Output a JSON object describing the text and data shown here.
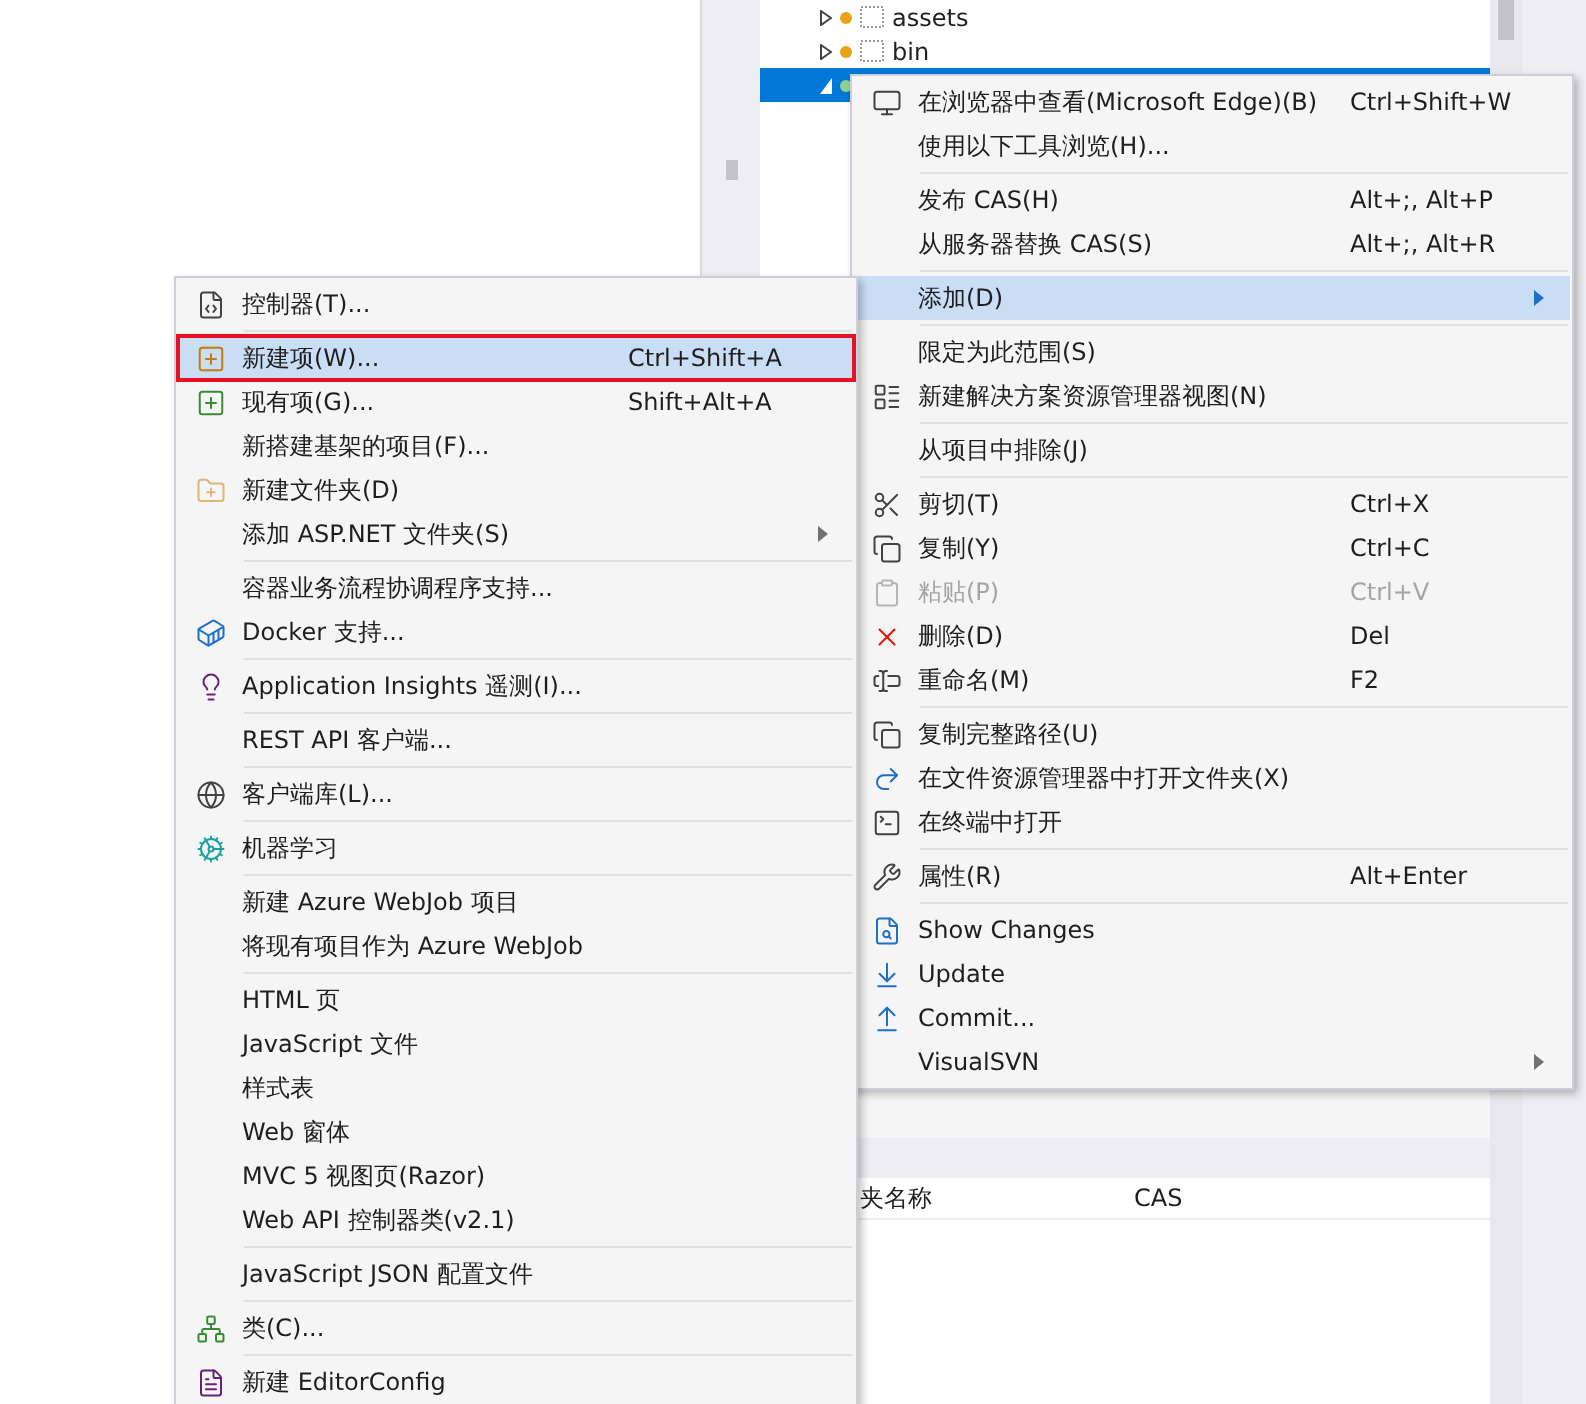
{
  "tree": [
    {
      "label": "assets",
      "selected": false
    },
    {
      "label": "bin",
      "selected": false
    },
    {
      "selected": true
    }
  ],
  "properties": {
    "name_label": "夹名称",
    "name_value": "CAS"
  },
  "context_menu": {
    "items": [
      {
        "kind": "item",
        "label": "在浏览器中查看(Microsoft Edge)(B)",
        "shortcut": "Ctrl+Shift+W",
        "selected": false,
        "disabled": false
      },
      {
        "kind": "item",
        "label": "使用以下工具浏览(H)...",
        "selected": false,
        "disabled": false
      },
      {
        "kind": "separator"
      },
      {
        "kind": "item",
        "label": "发布 CAS(H)",
        "shortcut": "Alt+;, Alt+P",
        "selected": false,
        "disabled": false
      },
      {
        "kind": "item",
        "label": "从服务器替换 CAS(S)",
        "shortcut": "Alt+;, Alt+R",
        "selected": false,
        "disabled": false
      },
      {
        "kind": "separator"
      },
      {
        "kind": "submenu",
        "label": "添加(D)",
        "selected": true,
        "disabled": false
      },
      {
        "kind": "separator"
      },
      {
        "kind": "item",
        "label": "限定为此范围(S)",
        "selected": false,
        "disabled": false
      },
      {
        "kind": "item",
        "label": "新建解决方案资源管理器视图(N)",
        "selected": false,
        "disabled": false
      },
      {
        "kind": "separator"
      },
      {
        "kind": "item",
        "label": "从项目中排除(J)",
        "selected": false,
        "disabled": false
      },
      {
        "kind": "separator"
      },
      {
        "kind": "item",
        "label": "剪切(T)",
        "shortcut": "Ctrl+X",
        "selected": false,
        "disabled": false
      },
      {
        "kind": "item",
        "label": "复制(Y)",
        "shortcut": "Ctrl+C",
        "selected": false,
        "disabled": false
      },
      {
        "kind": "item",
        "label": "粘贴(P)",
        "shortcut": "Ctrl+V",
        "selected": false,
        "disabled": true
      },
      {
        "kind": "item",
        "label": "删除(D)",
        "shortcut": "Del",
        "selected": false,
        "disabled": false
      },
      {
        "kind": "item",
        "label": "重命名(M)",
        "shortcut": "F2",
        "selected": false,
        "disabled": false
      },
      {
        "kind": "separator"
      },
      {
        "kind": "item",
        "label": "复制完整路径(U)",
        "selected": false,
        "disabled": false
      },
      {
        "kind": "item",
        "label": "在文件资源管理器中打开文件夹(X)",
        "selected": false,
        "disabled": false
      },
      {
        "kind": "item",
        "label": "在终端中打开",
        "selected": false,
        "disabled": false
      },
      {
        "kind": "separator"
      },
      {
        "kind": "item",
        "label": "属性(R)",
        "shortcut": "Alt+Enter",
        "selected": false,
        "disabled": false
      },
      {
        "kind": "separator"
      },
      {
        "kind": "item",
        "label": "Show Changes",
        "selected": false,
        "disabled": false
      },
      {
        "kind": "item",
        "label": "Update",
        "selected": false,
        "disabled": false
      },
      {
        "kind": "item",
        "label": "Commit...",
        "selected": false,
        "disabled": false
      },
      {
        "kind": "submenu",
        "label": "VisualSVN",
        "selected": false,
        "disabled": false
      }
    ]
  },
  "add_submenu": {
    "items": [
      {
        "kind": "item",
        "label": "控制器(T)...",
        "selected": false,
        "disabled": false
      },
      {
        "kind": "separator"
      },
      {
        "kind": "item",
        "label": "新建项(W)...",
        "shortcut": "Ctrl+Shift+A",
        "selected": true,
        "disabled": false
      },
      {
        "kind": "item",
        "label": "现有项(G)...",
        "shortcut": "Shift+Alt+A",
        "selected": false,
        "disabled": false
      },
      {
        "kind": "item",
        "label": "新搭建基架的项目(F)...",
        "selected": false,
        "disabled": false
      },
      {
        "kind": "item",
        "label": "新建文件夹(D)",
        "selected": false,
        "disabled": false
      },
      {
        "kind": "submenu",
        "label": "添加 ASP.NET 文件夹(S)",
        "selected": false,
        "disabled": false
      },
      {
        "kind": "separator"
      },
      {
        "kind": "item",
        "label": "容器业务流程协调程序支持...",
        "selected": false,
        "disabled": false
      },
      {
        "kind": "item",
        "label": "Docker 支持...",
        "selected": false,
        "disabled": false
      },
      {
        "kind": "separator"
      },
      {
        "kind": "item",
        "label": "Application Insights 遥测(I)...",
        "selected": false,
        "disabled": false
      },
      {
        "kind": "separator"
      },
      {
        "kind": "item",
        "label": "REST API 客户端...",
        "selected": false,
        "disabled": false
      },
      {
        "kind": "separator"
      },
      {
        "kind": "item",
        "label": "客户端库(L)...",
        "selected": false,
        "disabled": false
      },
      {
        "kind": "separator"
      },
      {
        "kind": "item",
        "label": "机器学习",
        "selected": false,
        "disabled": false
      },
      {
        "kind": "separator"
      },
      {
        "kind": "item",
        "label": "新建 Azure WebJob 项目",
        "selected": false,
        "disabled": false
      },
      {
        "kind": "item",
        "label": "将现有项目作为 Azure WebJob",
        "selected": false,
        "disabled": false
      },
      {
        "kind": "separator"
      },
      {
        "kind": "item",
        "label": "HTML 页",
        "selected": false,
        "disabled": false
      },
      {
        "kind": "item",
        "label": "JavaScript 文件",
        "selected": false,
        "disabled": false
      },
      {
        "kind": "item",
        "label": "样式表",
        "selected": false,
        "disabled": false
      },
      {
        "kind": "item",
        "label": "Web 窗体",
        "selected": false,
        "disabled": false
      },
      {
        "kind": "item",
        "label": "MVC 5 视图页(Razor)",
        "selected": false,
        "disabled": false
      },
      {
        "kind": "item",
        "label": "Web API 控制器类(v2.1)",
        "selected": false,
        "disabled": false
      },
      {
        "kind": "separator"
      },
      {
        "kind": "item",
        "label": "JavaScript JSON 配置文件",
        "selected": false,
        "disabled": false
      },
      {
        "kind": "separator"
      },
      {
        "kind": "item",
        "label": "类(C)...",
        "selected": false,
        "disabled": false
      },
      {
        "kind": "separator"
      },
      {
        "kind": "item",
        "label": "新建 EditorConfig",
        "selected": false,
        "disabled": false
      }
    ]
  }
}
